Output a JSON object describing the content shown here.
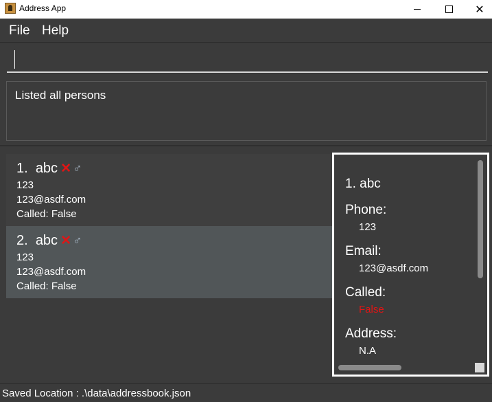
{
  "window": {
    "title": "Address App",
    "close_glyph": "✕"
  },
  "menu": {
    "file": "File",
    "help": "Help"
  },
  "command": {
    "value": ""
  },
  "result": {
    "text": "Listed all persons"
  },
  "persons": [
    {
      "index": "1.",
      "name": "abc",
      "called_icon": "✕",
      "gender_icon": "♂",
      "phone": "123",
      "email": "123@asdf.com",
      "called": "Called: False"
    },
    {
      "index": "2.",
      "name": "abc",
      "called_icon": "✕",
      "gender_icon": "♂",
      "phone": "123",
      "email": "123@asdf.com",
      "called": "Called: False"
    }
  ],
  "detail": {
    "name": "1.  abc",
    "phone_label": "Phone:",
    "phone": "123",
    "email_label": "Email:",
    "email": "123@asdf.com",
    "called_label": "Called:",
    "called": "False",
    "address_label": "Address:",
    "address": "N.A"
  },
  "status": {
    "text": "Saved Location : .\\data\\addressbook.json"
  },
  "colors": {
    "background": "#3b3b3b",
    "selected_card": "#515658",
    "called_false": "#e01515",
    "detail_border": "#ffffff"
  }
}
